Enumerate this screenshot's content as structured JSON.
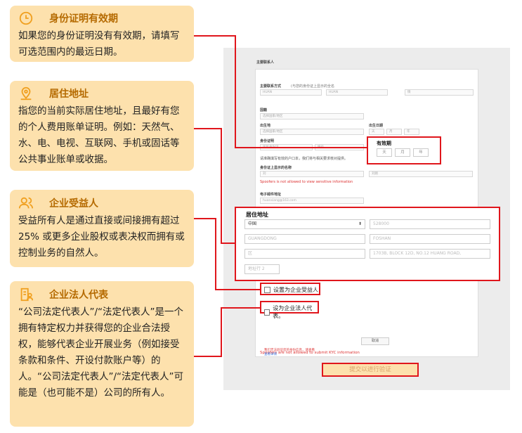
{
  "cards": [
    {
      "title": "身份证明有效期",
      "icon": "clock-icon",
      "body": "如果您的身份证明没有有效期，请填写可选范围内的最远日期。"
    },
    {
      "title": "居住地址",
      "icon": "location-pin-icon",
      "body": "指您的当前实际居住地址，且最好有您的个人费用账单证明。例如：天然气、水、电、电视、互联网、手机或固话等公共事业账单或收据。"
    },
    {
      "title": "企业受益人",
      "icon": "users-icon",
      "body": "受益所有人是通过直接或间接拥有超过 25% 或更多企业股权或表决权而拥有或控制业务的自然人。"
    },
    {
      "title": "企业法人代表",
      "icon": "document-person-icon",
      "body": "“公司法定代表人”/“法定代表人”是一个拥有特定权力并获得您的企业合法授权，能够代表企业开展业务（例如接受条款和条件、开设付款账户等）的人。“公司法定代表人”/“法定代表人”可能是（也可能不是）公司的所有人。"
    }
  ],
  "form": {
    "section_title": "主要联系人",
    "contact_label": "主要联系方式",
    "contact_hint": "(与您的身份证上显示的全名",
    "first_name": "HUAN",
    "last_name": "HUAN",
    "middle": "情",
    "country_label": "国籍",
    "country_placeholder": "选择国家/地区",
    "birthplace_label": "出生地",
    "birthplace_placeholder": "选择国家/地区",
    "dob_label": "出生日期",
    "dob_day": "天",
    "dob_month": "月",
    "dob_year": "年",
    "id_label": "身份证明",
    "id_type": "居民身份证",
    "id_number_placeholder": "编号",
    "id_note": "请准确填写有效的户口本，我们将与相关要求核对提供。",
    "id_name_label": "身份证上显示的名称",
    "id_name_value": "刘",
    "id_name_value2": "刘刚",
    "spoofer_note": "Spoofers is not allowed to view sensitive information",
    "email_label": "电子邮件地址",
    "email_value": "huanxiang@163.com",
    "spoofer_submit": "Spoofers are not allowed to submit KYC information",
    "footer_note": "我们无法验证您的身份信息，请查看",
    "footer_link": "查看详情",
    "cancel": "取消",
    "submit": "提交以进行验证"
  },
  "validity": {
    "title": "有效期",
    "day": "天",
    "month": "月",
    "year": "年"
  },
  "address": {
    "title": "居住地址",
    "country": "中国",
    "postal": "528000",
    "province": "GUANGDONG",
    "city": "FOSHAN",
    "district": "区",
    "street": "1703B, BLOCK 12D, NO.12 HUANG ROAD,",
    "line3": "地址行 2"
  },
  "checkboxes": {
    "beneficiary": "设置为企业受益人",
    "legal_rep": "设为企业法人代表。"
  }
}
